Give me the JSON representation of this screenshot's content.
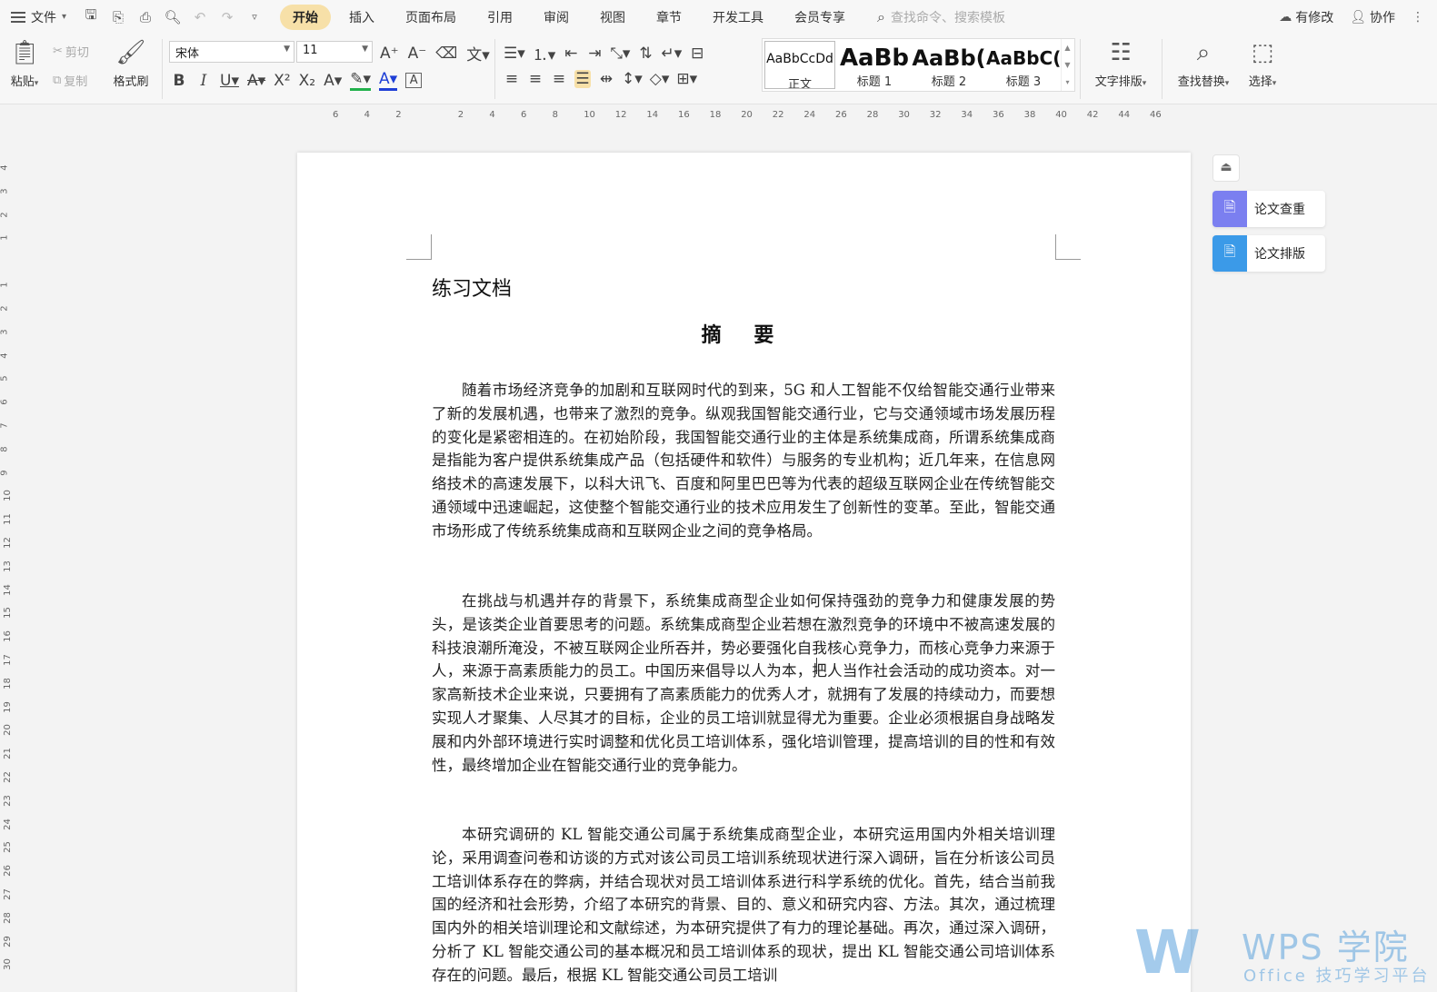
{
  "menubar": {
    "file_label": "文件",
    "tabs": [
      {
        "label": "开始",
        "active": true
      },
      {
        "label": "插入"
      },
      {
        "label": "页面布局"
      },
      {
        "label": "引用"
      },
      {
        "label": "审阅"
      },
      {
        "label": "视图"
      },
      {
        "label": "章节"
      },
      {
        "label": "开发工具"
      },
      {
        "label": "会员专享"
      }
    ],
    "search_placeholder": "查找命令、搜索模板",
    "right": {
      "changes": "有修改",
      "collab": "协作"
    }
  },
  "ribbon": {
    "paste": "粘贴",
    "cut": "剪切",
    "copy": "复制",
    "format_painter": "格式刷",
    "font_name": "宋体",
    "font_size": "11",
    "styles": [
      {
        "sample": "AaBbCcDd",
        "name": "正文"
      },
      {
        "sample": "AaBb",
        "name": "标题 1"
      },
      {
        "sample": "AaBb(",
        "name": "标题 2"
      },
      {
        "sample": "AaBbC(",
        "name": "标题 3"
      }
    ],
    "text_layout": "文字排版",
    "find_replace": "查找替换",
    "select": "选择",
    "colors": {
      "highlight": "#22b14c",
      "font": "#1f3fd6",
      "active_tab": "#f7e0a8"
    }
  },
  "ruler": {
    "h_numbers": [
      "6",
      "4",
      "2",
      "2",
      "4",
      "6",
      "8",
      "10",
      "12",
      "14",
      "16",
      "18",
      "20",
      "22",
      "24",
      "26",
      "28",
      "30",
      "32",
      "34",
      "36",
      "38",
      "40",
      "42",
      "44",
      "46"
    ],
    "v_numbers": [
      "4",
      "3",
      "2",
      "1",
      "1",
      "2",
      "3",
      "4",
      "5",
      "6",
      "7",
      "8",
      "9",
      "10",
      "11",
      "12",
      "13",
      "14",
      "15",
      "16",
      "17",
      "18",
      "19",
      "20",
      "21",
      "22",
      "23",
      "24",
      "25",
      "26",
      "27",
      "28",
      "29",
      "30"
    ]
  },
  "document": {
    "title": "练习文档",
    "abstract_heading": "摘  要",
    "paragraphs": [
      "随着市场经济竞争的加剧和互联网时代的到来，5G 和人工智能不仅给智能交通行业带来了新的发展机遇，也带来了激烈的竞争。纵观我国智能交通行业，它与交通领域市场发展历程的变化是紧密相连的。在初始阶段，我国智能交通行业的主体是系统集成商，所谓系统集成商是指能为客户提供系统集成产品（包括硬件和软件）与服务的专业机构；近几年来，在信息网络技术的高速发展下，以科大讯飞、百度和阿里巴巴等为代表的超级互联网企业在传统智能交通领域中迅速崛起，这使整个智能交通行业的技术应用发生了创新性的变革。至此，智能交通市场形成了传统系统集成商和互联网企业之间的竞争格局。",
      "在挑战与机遇并存的背景下，系统集成商型企业如何保持强劲的竞争力和健康发展的势头，是该类企业首要思考的问题。系统集成商型企业若想在激烈竞争的环境中不被高速发展的科技浪潮所淹没，不被互联网企业所吞并，势必要强化自我核心竞争力，而核心竞争力来源于人，来源于高素质能力的员工。中国历来倡导以人为本，把人当作社会活动的成功资本。对一家高新技术企业来说，只要拥有了高素质能力的优秀人才，就拥有了发展的持续动力，而要想实现人才聚集、人尽其才的目标，企业的员工培训就显得尤为重要。企业必须根据自身战略发展和内外部环境进行实时调整和优化员工培训体系，强化培训管理，提高培训的目的性和有效性，最终增加企业在智能交通行业的竞争能力。",
      "本研究调研的 KL 智能交通公司属于系统集成商型企业，本研究运用国内外相关培训理论，采用调查问卷和访谈的方式对该公司员工培训系统现状进行深入调研，旨在分析该公司员工培训体系存在的弊病，并结合现状对员工培训体系进行科学系统的优化。首先，结合当前我国的经济和社会形势，介绍了本研究的背景、目的、意义和研究内容、方法。其次，通过梳理国内外的相关培训理论和文献综述，为本研究提供了有力的理论基础。再次，通过深入调研，分析了 KL 智能交通公司的基本概况和员工培训体系的现状，提出 KL 智能交通公司培训体系存在的问题。最后，根据 KL 智能交通公司员工培训"
    ]
  },
  "side_panel": {
    "plagiarism_check": "论文查重",
    "thesis_format": "论文排版",
    "colors": {
      "check": "#7b7ff0",
      "format": "#3b9ae8"
    }
  },
  "watermark": {
    "brand": "WPS 学院",
    "tagline": "Office 技巧学习平台"
  }
}
